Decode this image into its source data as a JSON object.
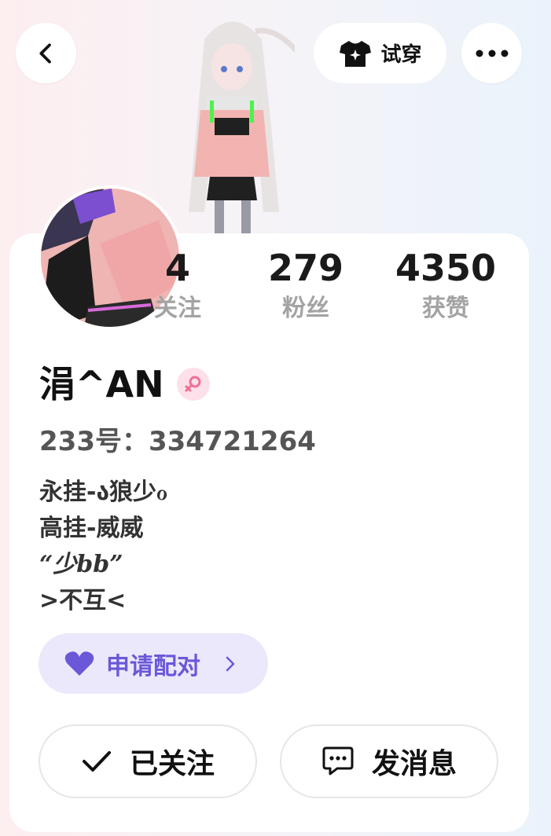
{
  "header": {
    "back_icon": "chevron-left-icon",
    "try_on_label": "试穿",
    "try_on_icon": "tshirt-icon",
    "more_icon": "more-dots-icon"
  },
  "profile": {
    "stats": [
      {
        "value": "4",
        "label": "关注"
      },
      {
        "value": "279",
        "label": "粉丝"
      },
      {
        "value": "4350",
        "label": "获赞"
      }
    ],
    "name": "涓^AN",
    "gender_icon": "female-icon",
    "uid_text": "233号：334721264",
    "bio_lines": [
      "永挂-ა狼少ℴ",
      "高挂-威威",
      "“少bb”",
      ">不互<"
    ]
  },
  "actions": {
    "match_label": "申请配对",
    "follow_label": "已关注",
    "message_label": "发消息"
  },
  "colors": {
    "accent_purple": "#6a58d8",
    "gender_pink": "#f06f95"
  }
}
